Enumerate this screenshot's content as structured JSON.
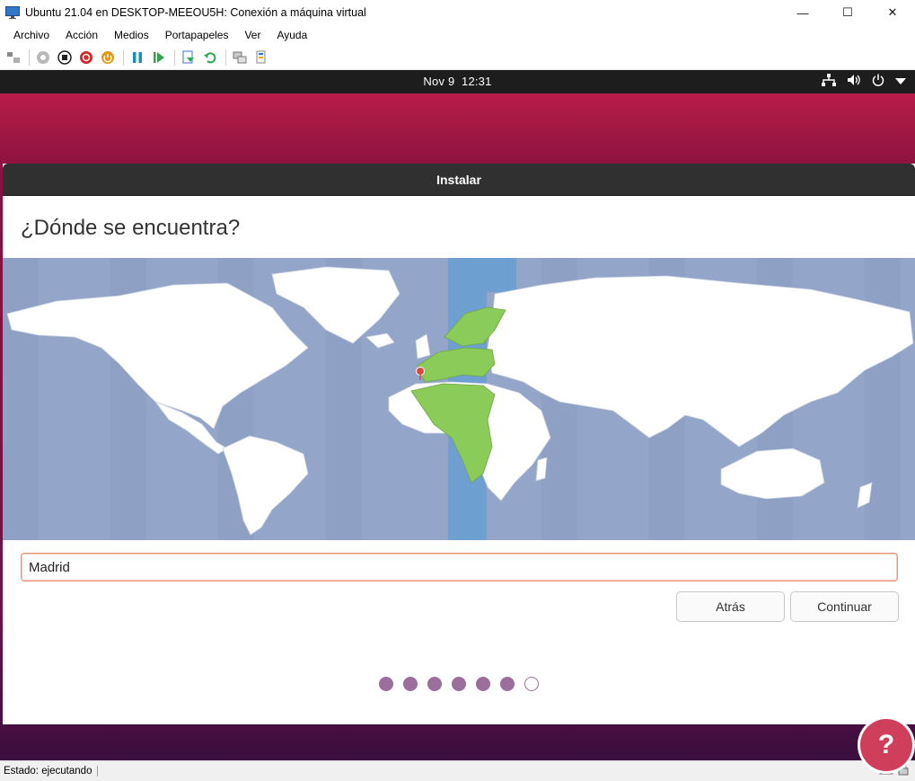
{
  "window": {
    "title": "Ubuntu 21.04 en DESKTOP-MEEOU5H: Conexión a máquina virtual",
    "minimize": "—",
    "maximize": "☐",
    "close": "✕"
  },
  "menu": {
    "items": [
      "Archivo",
      "Acción",
      "Medios",
      "Portapapeles",
      "Ver",
      "Ayuda"
    ]
  },
  "vm": {
    "topbar": {
      "date": "Nov 9",
      "time": "12:31"
    },
    "installer": {
      "header": "Instalar",
      "title": "¿Dónde se encuentra?",
      "city_value": "Madrid",
      "back_label": "Atrás",
      "continue_label": "Continuar",
      "steps_total": 7,
      "steps_done": 6
    }
  },
  "status": {
    "text": "Estado: ejecutando"
  },
  "watermark": {
    "glyph": "?"
  },
  "colors": {
    "ocean": "#93a5c8",
    "land": "#ffffff",
    "selected_zone": "#6d9fd0",
    "selected_land": "#8bcb5a",
    "progress_dot": "#9c6e9e",
    "input_border": "#e9967a"
  }
}
